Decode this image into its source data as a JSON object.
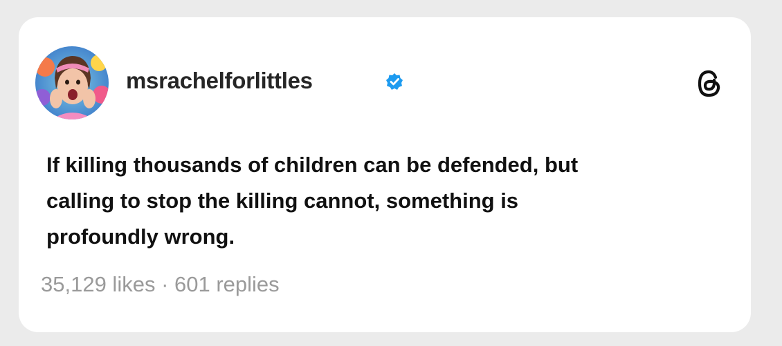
{
  "post": {
    "username": "msrachelforlittles",
    "verified": true,
    "text": "If killing thousands of children can be defended, but\ncalling to stop the killing cannot, something is\nprofoundly wrong.",
    "likes": "35,129 likes",
    "separator": " · ",
    "replies": "601 replies"
  },
  "icons": {
    "verified": "verified-badge-icon",
    "platform": "threads-logo-icon"
  },
  "colors": {
    "verified_blue": "#1d9bf0",
    "text": "#111111",
    "muted": "#9a9a9a",
    "background": "#ebebeb"
  }
}
